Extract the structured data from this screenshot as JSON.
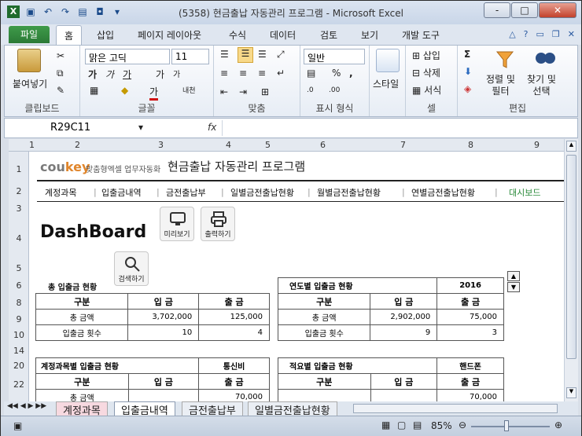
{
  "window": {
    "title": "(5358) 현금출납 자동관리 프로그램 - Microsoft Excel",
    "controls": [
      "-",
      "□",
      "✕"
    ]
  },
  "ribbon_tabs": [
    "파일",
    "홈",
    "삽입",
    "페이지 레이아웃",
    "수식",
    "데이터",
    "검토",
    "보기",
    "개발 도구"
  ],
  "ribbon": {
    "clipboard": {
      "paste": "붙여넣기",
      "label": "클립보드"
    },
    "font": {
      "name": "맑은 고딕",
      "size": "11",
      "label": "글꼴",
      "bold": "가",
      "italic": "가",
      "underline": "가",
      "grow": "가",
      "shrink": "가",
      "color": "가",
      "phonetic": "내천"
    },
    "align": {
      "label": "맞춤"
    },
    "number": {
      "format": "일반",
      "label": "표시 형식"
    },
    "styles": {
      "btn": "스타일"
    },
    "cells": {
      "insert": "삽입",
      "delete": "삭제",
      "format": "서식",
      "label": "셀"
    },
    "editing": {
      "sort": "정렬 및\n필터",
      "find": "찾기 및\n선택",
      "label": "편집"
    }
  },
  "formula": {
    "namebox": "R29C11",
    "fx": "fx"
  },
  "columns": [
    "1",
    "2",
    "3",
    "4",
    "5",
    "6",
    "7",
    "8",
    "9"
  ],
  "rows": [
    "1",
    "2",
    "3",
    "4",
    "5",
    "6",
    "8",
    "9",
    "10",
    "14",
    "20",
    "22"
  ],
  "app": {
    "logo_a": "cou",
    "logo_b": "key",
    "logo_sub": "맞춤형엑셀 업무자동화",
    "title": "현금출납 자동관리 프로그램",
    "nav": [
      "계정과목",
      "입출금내역",
      "금전출납부",
      "일별금전출납현황",
      "월별금전출납현황",
      "연별금전출납현황",
      "대시보드"
    ],
    "heading": "DashBoard",
    "btn_preview": "미리보기",
    "btn_print": "출력하기",
    "btn_search": "검색하기"
  },
  "table_total": {
    "title": "총 입출금 현황",
    "headers": [
      "구분",
      "입 금",
      "출 금"
    ],
    "rows": [
      [
        "총 금액",
        "3,702,000",
        "125,000"
      ],
      [
        "입출금 횟수",
        "10",
        "4"
      ]
    ]
  },
  "table_year": {
    "title": "연도별 입출금 현황",
    "year": "2016",
    "headers": [
      "구분",
      "입 금",
      "출 금"
    ],
    "rows": [
      [
        "총 금액",
        "2,902,000",
        "75,000"
      ],
      [
        "입출금 횟수",
        "9",
        "3"
      ]
    ]
  },
  "table_account": {
    "title": "계정과목별 입출금 현황",
    "account": "통신비",
    "headers": [
      "구분",
      "입 금",
      "출 금"
    ],
    "row_value": "70,000",
    "row_label": "총 금액"
  },
  "table_memo": {
    "title": "적요별 입출금 현황",
    "memo": "핸드폰",
    "headers": [
      "구분",
      "입 금",
      "출 금"
    ],
    "row_value": "70,000"
  },
  "sheet_tabs": [
    "계정과목",
    "입출금내역",
    "금전출납부",
    "일별금전출납현황"
  ],
  "status": {
    "zoom": "85%"
  }
}
